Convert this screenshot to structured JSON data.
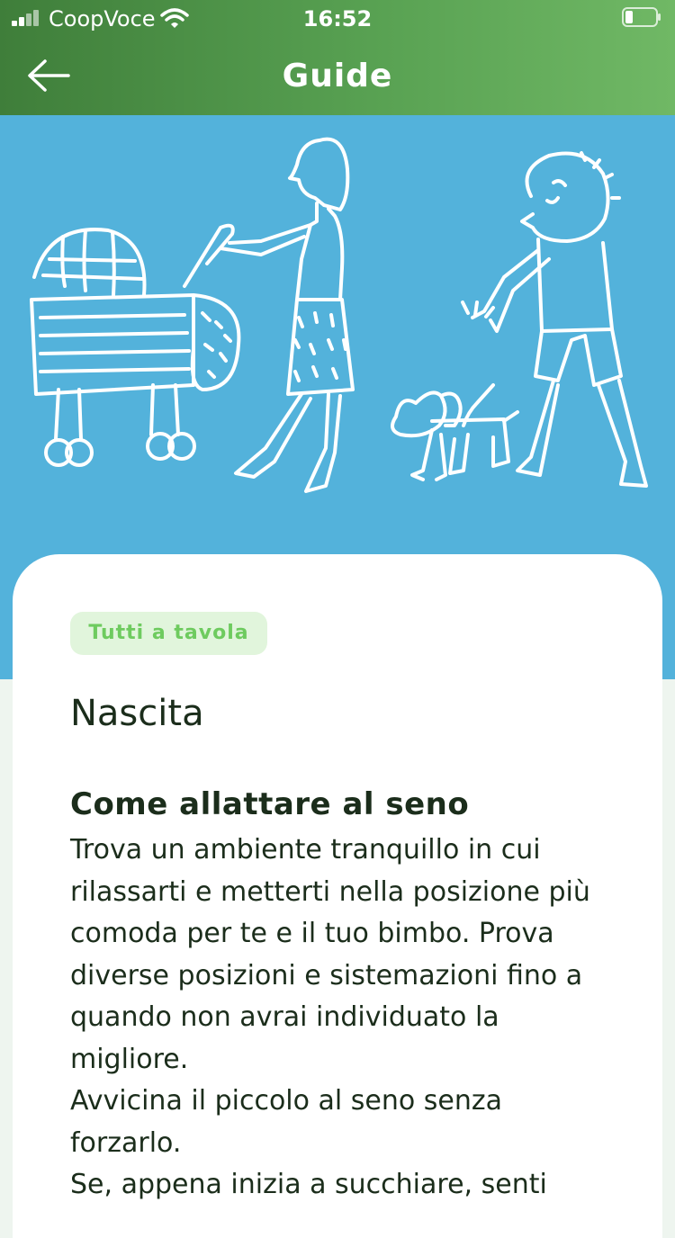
{
  "status_bar": {
    "carrier": "CoopVoce",
    "time": "16:52"
  },
  "header": {
    "title": "Guide"
  },
  "article": {
    "tag": "Tutti a tavola",
    "category_title": "Nascita",
    "section_title": "Come allattare al seno",
    "paragraphs": [
      "Trova un ambiente tranquillo in cui rilassarti e metterti nella posizione più comoda per te e il tuo bimbo. Prova diverse posizioni e sistemazioni fino a quando non avrai individuato la migliore.",
      "Avvicina il piccolo al seno senza forzarlo.",
      "Se, appena inizia a succhiare, senti"
    ]
  },
  "colors": {
    "header_start": "#3f7e3a",
    "header_end": "#70b865",
    "hero_background": "#53b2db",
    "tag_background": "#e1f5dc",
    "tag_text": "#6ecb5f"
  },
  "icons": [
    "signal-icon",
    "wifi-icon",
    "battery-icon",
    "back-arrow-icon"
  ]
}
